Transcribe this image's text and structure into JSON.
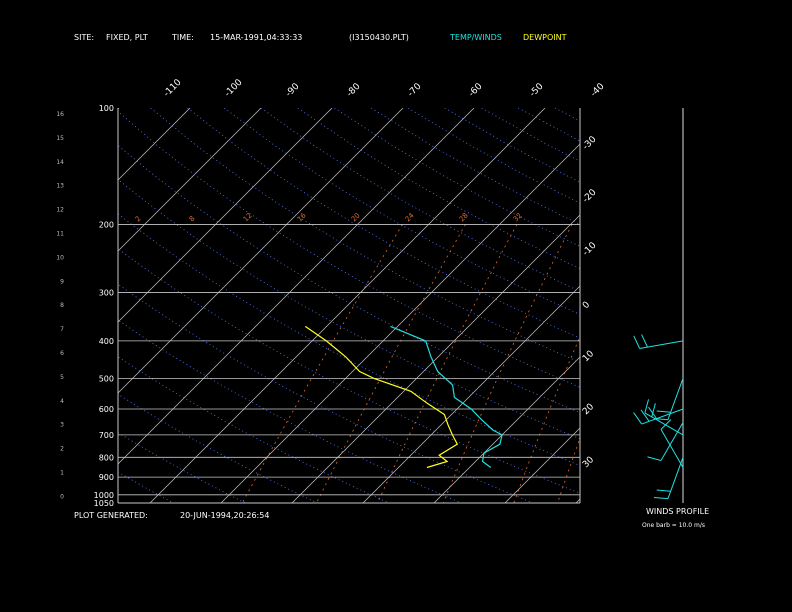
{
  "header": {
    "site_label": "SITE:",
    "site_value": "FIXED, PLT",
    "time_label": "TIME:",
    "time_value": "15-MAR-1991,04:33:33",
    "file": "(I3150430.PLT)",
    "legend_temp": "TEMP/WINDS",
    "legend_dew": "DEWPOINT"
  },
  "footer": {
    "generated_label": "PLOT GENERATED:",
    "generated_value": "20-JUN-1994,20:26:54"
  },
  "winds_panel": {
    "title": "WINDS PROFILE",
    "note": "One barb = 10.0 m/s"
  },
  "colors": {
    "temp": "#22e0e0",
    "dewpoint": "#ffff22",
    "grid": "#c8c8c8",
    "dry_adiabat": "#5a7aff",
    "mixing_ratio": "#e06a2a"
  },
  "chart_data": {
    "type": "line",
    "pressure_levels": [
      100,
      200,
      300,
      400,
      500,
      600,
      700,
      800,
      900,
      1000,
      1050
    ],
    "height_km_ticks": [
      "16",
      "15",
      "14",
      "13",
      "12",
      "11",
      "10",
      "9",
      "8",
      "7",
      "6",
      "5",
      "4",
      "3",
      "2",
      "1",
      "0"
    ],
    "top_temp_labels": [
      "-110",
      "-100",
      "-90",
      "-80",
      "-70",
      "-60",
      "-50",
      "-40"
    ],
    "right_temp_labels": [
      "-30",
      "-20",
      "-10",
      "0",
      "10",
      "20",
      "30"
    ],
    "mixing_ratio_labels": [
      "2",
      "8",
      "12",
      "16",
      "20",
      "24",
      "28",
      "32"
    ],
    "series": [
      {
        "name": "TEMP/WINDS",
        "points": [
          [
            -31,
            367
          ],
          [
            -24,
            400
          ],
          [
            -21,
            440
          ],
          [
            -18,
            480
          ],
          [
            -14,
            520
          ],
          [
            -12,
            560
          ],
          [
            -8,
            600
          ],
          [
            -5,
            640
          ],
          [
            -2,
            680
          ],
          [
            0,
            700
          ],
          [
            1,
            740
          ],
          [
            0,
            780
          ],
          [
            1,
            820
          ],
          [
            3,
            850
          ]
        ]
      },
      {
        "name": "DEWPOINT",
        "points": [
          [
            -43,
            367
          ],
          [
            -38,
            400
          ],
          [
            -33,
            440
          ],
          [
            -29,
            480
          ],
          [
            -26,
            500
          ],
          [
            -19,
            540
          ],
          [
            -15,
            580
          ],
          [
            -11,
            620
          ],
          [
            -9,
            660
          ],
          [
            -7,
            700
          ],
          [
            -5,
            740
          ],
          [
            -6,
            790
          ],
          [
            -4,
            820
          ],
          [
            -6,
            850
          ]
        ]
      }
    ],
    "winds": [
      {
        "pressure": 850,
        "dir": 330,
        "speed": 10
      },
      {
        "pressure": 800,
        "dir": 200,
        "speed": 20
      },
      {
        "pressure": 700,
        "dir": 300,
        "speed": 20
      },
      {
        "pressure": 650,
        "dir": 210,
        "speed": 10
      },
      {
        "pressure": 600,
        "dir": 250,
        "speed": 30
      },
      {
        "pressure": 500,
        "dir": 200,
        "speed": 20
      },
      {
        "pressure": 400,
        "dir": 260,
        "speed": 20
      }
    ]
  }
}
